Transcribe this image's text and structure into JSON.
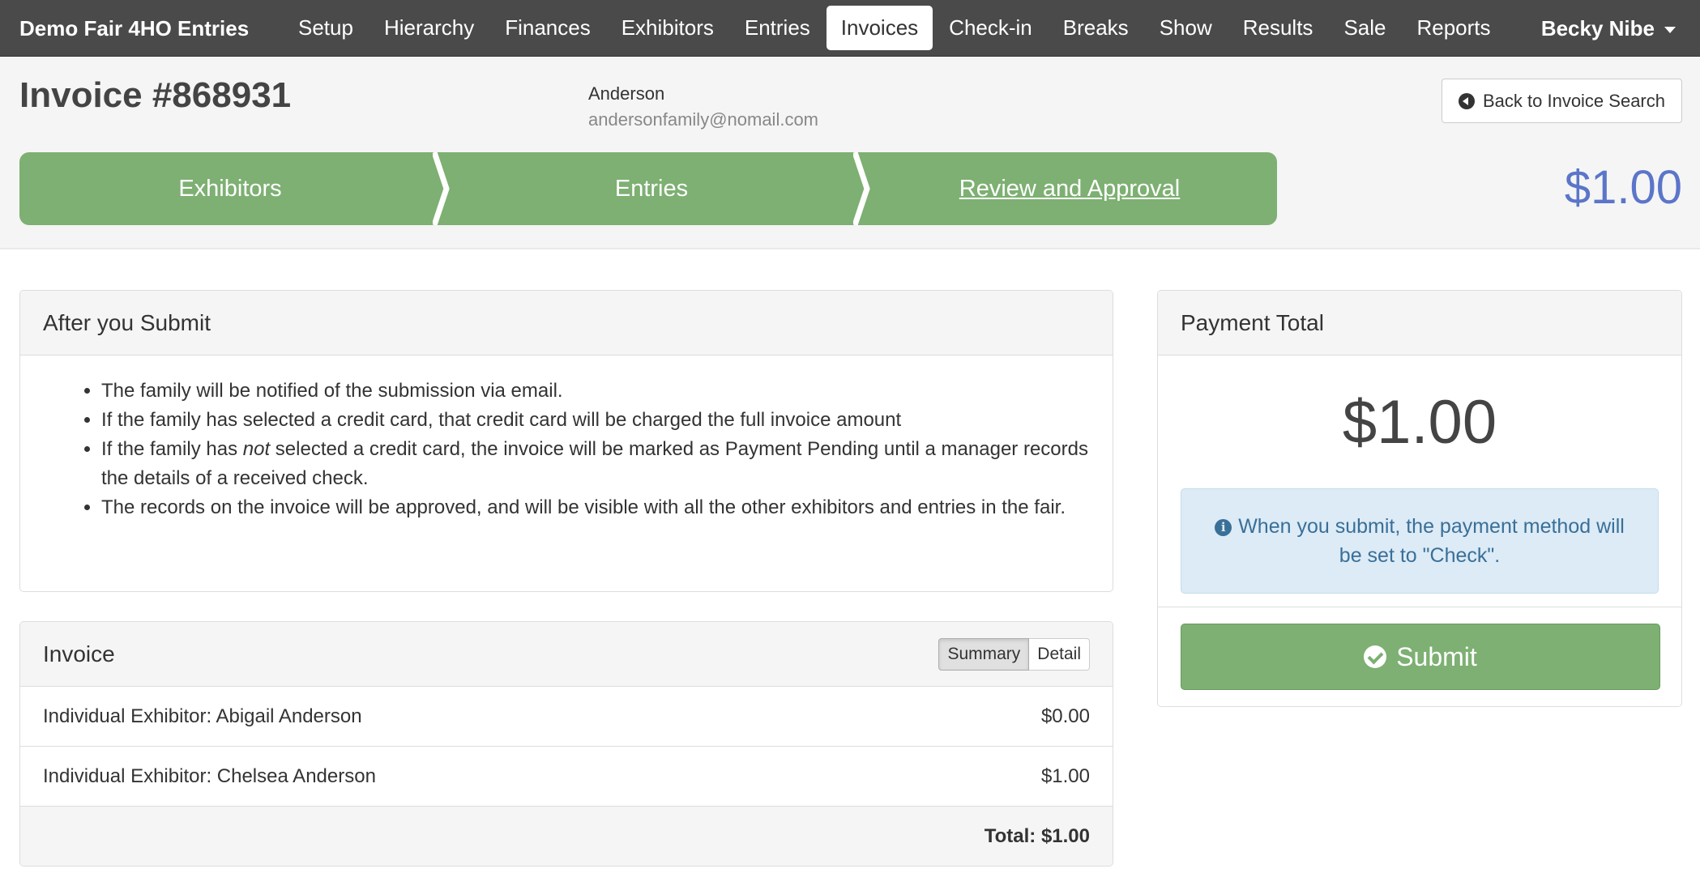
{
  "navbar": {
    "brand": "Demo Fair 4HO Entries",
    "items": [
      {
        "label": "Setup"
      },
      {
        "label": "Hierarchy"
      },
      {
        "label": "Finances"
      },
      {
        "label": "Exhibitors"
      },
      {
        "label": "Entries"
      },
      {
        "label": "Invoices",
        "active": true
      },
      {
        "label": "Check-in"
      },
      {
        "label": "Breaks"
      },
      {
        "label": "Show"
      },
      {
        "label": "Results"
      },
      {
        "label": "Sale"
      },
      {
        "label": "Reports"
      }
    ],
    "user": "Becky Nibe"
  },
  "header": {
    "title": "Invoice #868931",
    "family_name": "Anderson",
    "family_email": "andersonfamily@nomail.com",
    "back_label": "Back to Invoice Search",
    "amount": "$1.00"
  },
  "wizard": {
    "steps": [
      {
        "label": "Exhibitors"
      },
      {
        "label": "Entries"
      },
      {
        "label": "Review and Approval",
        "current": true
      }
    ]
  },
  "after_submit": {
    "title": "After you Submit",
    "items": [
      "The family will be notified of the submission via email.",
      "If the family has selected a credit card, that credit card will be charged the full invoice amount",
      {
        "pre": "If the family has ",
        "em": "not",
        "post": " selected a credit card, the invoice will be marked as Payment Pending until a manager records the details of a received check."
      },
      "The records on the invoice will be approved, and will be visible with all the other exhibitors and entries in the fair."
    ]
  },
  "invoice": {
    "title": "Invoice",
    "toggle": {
      "summary": "Summary",
      "detail": "Detail"
    },
    "rows": [
      {
        "label": "Individual Exhibitor: Abigail Anderson",
        "amount": "$0.00"
      },
      {
        "label": "Individual Exhibitor: Chelsea Anderson",
        "amount": "$1.00"
      }
    ],
    "total": "Total: $1.00"
  },
  "payment": {
    "title": "Payment Total",
    "amount": "$1.00",
    "notice": "When you submit, the payment method will be set to \"Check\".",
    "submit_label": "Submit"
  },
  "colors": {
    "navbar": "#4a4a4a",
    "success_green": "#7db072",
    "amount_blue": "#5b75c9",
    "info_bg": "#dcebf6",
    "info_text": "#3a6f98"
  },
  "icons": {
    "back": "circle-arrow-left-icon",
    "info": "info-circle-icon",
    "submit": "check-circle-icon",
    "user_menu": "caret-down-icon"
  }
}
